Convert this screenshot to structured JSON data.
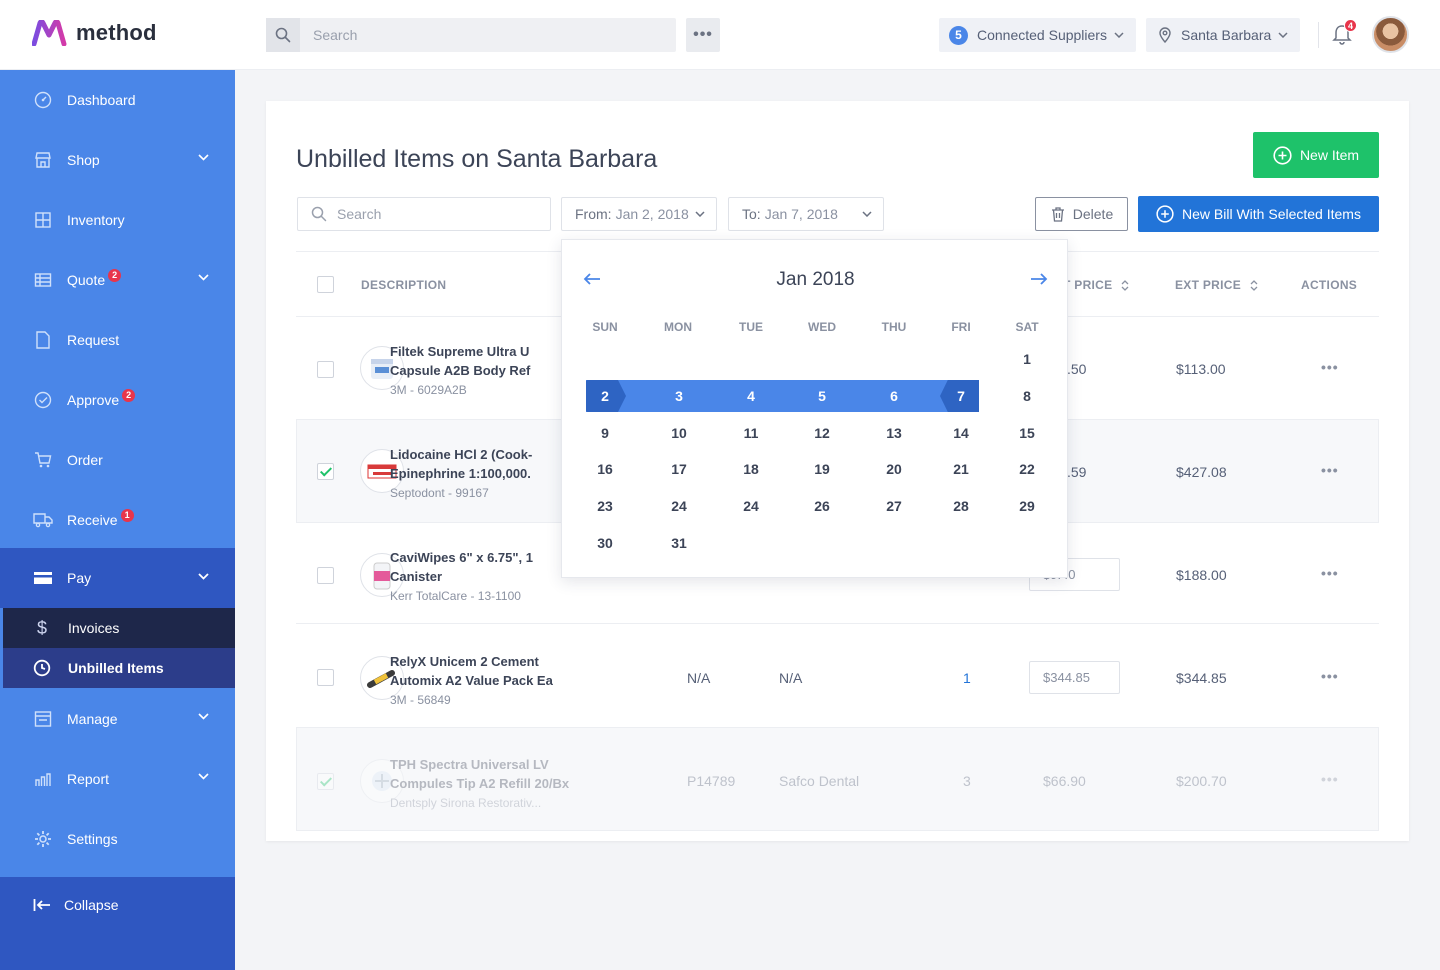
{
  "app": {
    "name": "method"
  },
  "topbar": {
    "search_placeholder": "Search",
    "suppliers_count": "5",
    "suppliers_label": "Connected Suppliers",
    "location_label": "Santa Barbara",
    "notifications_count": "4"
  },
  "sidebar": {
    "items": [
      {
        "label": "Dashboard",
        "icon": "dashboard-icon"
      },
      {
        "label": "Shop",
        "icon": "shop-icon",
        "expandable": true
      },
      {
        "label": "Inventory",
        "icon": "inventory-icon"
      },
      {
        "label": "Quote",
        "icon": "quote-icon",
        "badge": "2",
        "expandable": true
      },
      {
        "label": "Request",
        "icon": "request-icon"
      },
      {
        "label": "Approve",
        "icon": "approve-icon",
        "badge": "2"
      },
      {
        "label": "Order",
        "icon": "cart-icon"
      },
      {
        "label": "Receive",
        "icon": "truck-icon",
        "badge": "1"
      },
      {
        "label": "Pay",
        "icon": "card-icon",
        "expandable": true
      },
      {
        "label": "Manage",
        "icon": "manage-icon",
        "expandable": true
      },
      {
        "label": "Report",
        "icon": "report-icon",
        "expandable": true
      },
      {
        "label": "Settings",
        "icon": "gear-icon"
      }
    ],
    "pay_sub": [
      {
        "label": "Invoices",
        "icon": "dollar-icon"
      },
      {
        "label": "Unbilled Items",
        "icon": "clock-icon"
      }
    ],
    "collapse_label": "Collapse"
  },
  "page": {
    "title": "Unbilled Items on Santa Barbara",
    "new_item_label": "New Item",
    "search_placeholder": "Search",
    "from_label": "From:",
    "from_value": "Jan 2, 2018",
    "to_label": "To:",
    "to_value": "Jan 7, 2018",
    "delete_label": "Delete",
    "new_bill_label": "New Bill With Selected Items"
  },
  "table": {
    "headers": {
      "description": "DESCRIPTION",
      "unit_price": "T PRICE",
      "ext_price": "EXT PRICE",
      "actions": "ACTIONS"
    },
    "rows": [
      {
        "name1": "Filtek Supreme Ultra U",
        "name2": "Capsule A2B Body Ref",
        "sub": "3M - 6029A2B",
        "unit": ".50",
        "ext": "$113.00",
        "checked": false
      },
      {
        "name1": "Lidocaine HCl 2 (Cook-",
        "name2": "Epinephrine 1:100,000.",
        "sub": "Septodont - 99167",
        "unit": ".59",
        "ext": "$427.08",
        "checked": true
      },
      {
        "name1": "CaviWipes 6\" x 6.75\", 1",
        "name2": "Canister",
        "sub": "Kerr TotalCare - 13-1100",
        "unit": "$9.40",
        "ext": "$188.00",
        "checked": false
      },
      {
        "name1": "RelyX Unicem 2 Cement",
        "name2": "Automix A2 Value Pack Ea",
        "sub": "3M - 56849",
        "sku": "N/A",
        "supplier": "N/A",
        "qty": "1",
        "unit": "$344.85",
        "ext": "$344.85",
        "checked": false
      },
      {
        "name1": "TPH Spectra Universal LV",
        "name2": "Compules Tip A2 Refill 20/Bx",
        "sub": "Dentsply Sirona Restorativ...",
        "sku": "P14789",
        "supplier": "Safco Dental",
        "qty": "3",
        "unit": "$66.90",
        "ext": "$200.70",
        "checked": true
      }
    ]
  },
  "calendar": {
    "month": "Jan 2018",
    "dow": [
      "SUN",
      "MON",
      "TUE",
      "WED",
      "THU",
      "FRI",
      "SAT"
    ],
    "weeks": [
      [
        "",
        "",
        "",
        "",
        "",
        "",
        "1"
      ],
      [
        "2",
        "3",
        "4",
        "5",
        "6",
        "7",
        "8"
      ],
      [
        "9",
        "10",
        "11",
        "12",
        "13",
        "14",
        "15"
      ],
      [
        "16",
        "17",
        "18",
        "19",
        "20",
        "21",
        "22"
      ],
      [
        "23",
        "24",
        "24",
        "26",
        "27",
        "28",
        "29"
      ],
      [
        "30",
        "31",
        "",
        "",
        "",
        "",
        ""
      ]
    ],
    "range_start": "2",
    "range_end": "7"
  },
  "colors": {
    "sidebar": "#4a86e8",
    "primary": "#2274d8",
    "success": "#1ec26a",
    "badge": "#e8354b"
  }
}
